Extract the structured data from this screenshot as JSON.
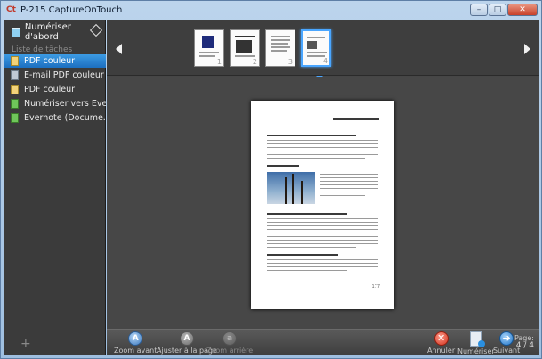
{
  "window": {
    "title": "P-215 CaptureOnTouch",
    "logo": "Ct",
    "minimize": "–",
    "maximize": "□",
    "close": "✕"
  },
  "sidebar": {
    "scan_first": "Numériser d'abord",
    "task_heading": "Liste de tâches",
    "tasks": [
      {
        "label": "PDF couleur",
        "icon": "pdf-icon",
        "selected": true
      },
      {
        "label": "E-mail PDF couleur",
        "icon": "mail-icon",
        "selected": false
      },
      {
        "label": "PDF couleur",
        "icon": "pdf-icon",
        "selected": false
      },
      {
        "label": "Numériser vers Eve...",
        "icon": "evernote-icon",
        "selected": false
      },
      {
        "label": "Evernote (Docume...",
        "icon": "evernote-icon",
        "selected": false
      }
    ],
    "add": "+"
  },
  "thumbnails": {
    "pages": [
      "1",
      "2",
      "3",
      "4"
    ],
    "active_index": 3
  },
  "preview": {
    "page_number": "177"
  },
  "toolbar": {
    "zoom_in": "Zoom avant",
    "fit_page": "Ajuster à la page",
    "zoom_out": "Zoom arrière",
    "cancel": "Annuler",
    "scan": "Numériser",
    "next": "Suivant",
    "page_label": "Page:",
    "page_count": "4 / 4"
  },
  "colors": {
    "accent": "#2f86d6",
    "sidebar_bg": "#3b3b3b",
    "main_bg": "#474747"
  }
}
